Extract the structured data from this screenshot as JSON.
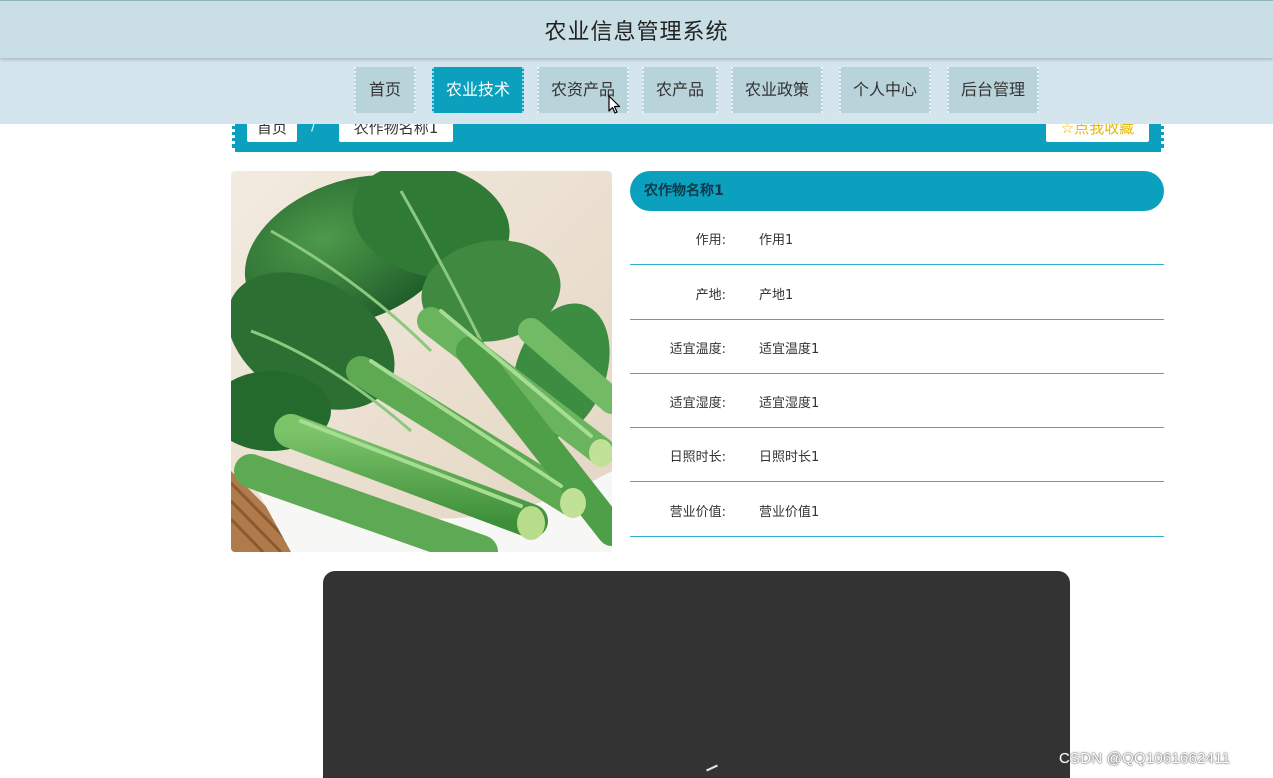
{
  "header": {
    "title": "农业信息管理系统"
  },
  "nav": {
    "items": [
      {
        "label": "首页"
      },
      {
        "label": "农业技术",
        "active": true
      },
      {
        "label": "农资产品"
      },
      {
        "label": "农产品"
      },
      {
        "label": "农业政策"
      },
      {
        "label": "个人中心"
      },
      {
        "label": "后台管理"
      }
    ]
  },
  "breadcrumb": {
    "home": "首页",
    "separator": "/",
    "current": "农作物名称1",
    "favorite_label": "☆点我收藏"
  },
  "detail": {
    "name": "农作物名称1",
    "rows": [
      {
        "label": "作用:",
        "value": "作用1"
      },
      {
        "label": "产地:",
        "value": "产地1"
      },
      {
        "label": "适宜温度:",
        "value": "适宜温度1"
      },
      {
        "label": "适宜湿度:",
        "value": "适宜湿度1"
      },
      {
        "label": "日照时长:",
        "value": "日照时长1"
      },
      {
        "label": "营业价值:",
        "value": "营业价值1"
      }
    ]
  },
  "watermark": "CSDN @QQ1061662411",
  "colors": {
    "accent": "#0aa0be",
    "header_bg": "#c9dfe5",
    "nav_bg": "#d5e5ee",
    "nav_item_bg": "#b9d3da",
    "video_bg": "#333333",
    "favorite": "#e6b800"
  }
}
